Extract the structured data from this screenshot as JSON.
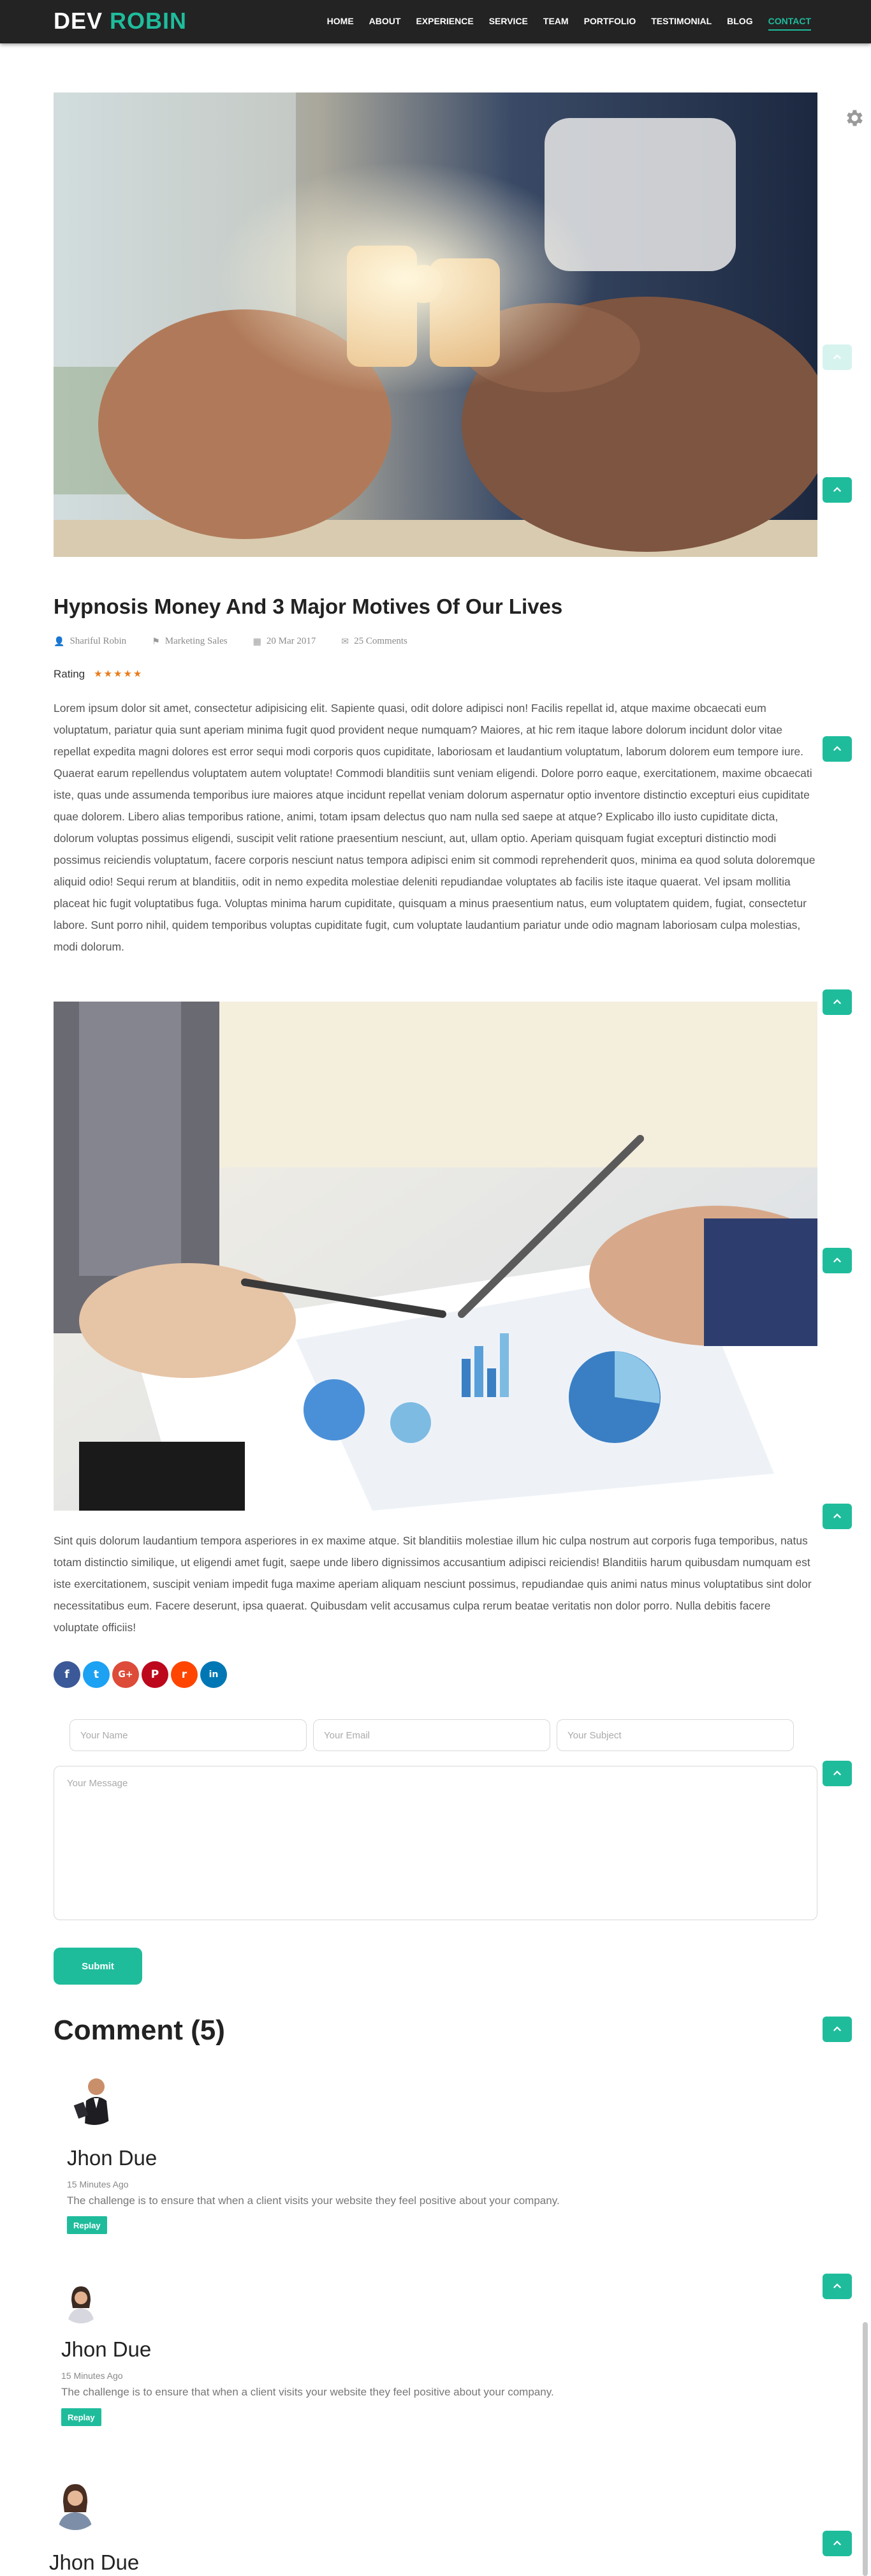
{
  "header": {
    "logo_part1": "DEV",
    "logo_part2": "ROBIN",
    "nav": [
      "HOME",
      "ABOUT",
      "EXPERIENCE",
      "SERVICE",
      "TEAM",
      "PORTFOLIO",
      "TESTIMONIAL",
      "BLOG",
      "CONTACT"
    ],
    "active_nav": "CONTACT"
  },
  "post": {
    "title": "Hypnosis Money And 3 Major Motives Of Our Lives",
    "author": "Shariful Robin",
    "category": "Marketing Sales",
    "date": "20 Mar 2017",
    "comments": "25 Comments",
    "rating_label": "Rating",
    "rating_stars": "★★★★★",
    "paragraph1": "Lorem ipsum dolor sit amet, consectetur adipisicing elit. Sapiente quasi, odit dolore adipisci non! Facilis repellat id, atque maxime obcaecati eum voluptatum, pariatur quia sunt aperiam minima fugit quod provident neque numquam? Maiores, at hic rem itaque labore dolorum incidunt dolor vitae repellat expedita magni dolores est error sequi modi corporis quos cupiditate, laboriosam et laudantium voluptatum, laborum dolorem eum tempore iure. Quaerat earum repellendus voluptatem autem voluptate! Commodi blanditiis sunt veniam eligendi. Dolore porro eaque, exercitationem, maxime obcaecati iste, quas unde assumenda temporibus iure maiores atque incidunt repellat veniam dolorum aspernatur optio inventore distinctio excepturi eius cupiditate quae dolorem. Libero alias temporibus ratione, animi, totam ipsam delectus quo nam nulla sed saepe at atque? Explicabo illo iusto cupiditate dicta, dolorum voluptas possimus eligendi, suscipit velit ratione praesentium nesciunt, aut, ullam optio. Aperiam quisquam fugiat excepturi distinctio modi possimus reiciendis voluptatum, facere corporis nesciunt natus tempora adipisci enim sit commodi reprehenderit quos, minima ea quod soluta doloremque aliquid odio! Sequi rerum at blanditiis, odit in nemo expedita molestiae deleniti repudiandae voluptates ab facilis iste itaque quaerat. Vel ipsam mollitia placeat hic fugit voluptatibus fuga. Voluptas minima harum cupiditate, quisquam a minus praesentium natus, eum voluptatem quidem, fugiat, consectetur labore. Sunt porro nihil, quidem temporibus voluptas cupiditate fugit, cum voluptate laudantium pariatur unde odio magnam laboriosam culpa molestias, modi dolorum.",
    "paragraph2": "Sint quis dolorum laudantium tempora asperiores in ex maxime atque. Sit blanditiis molestiae illum hic culpa nostrum aut corporis fuga temporibus, natus totam distinctio similique, ut eligendi amet fugit, saepe unde libero dignissimos accusantium adipisci reiciendis! Blanditiis harum quibusdam numquam est iste exercitationem, suscipit veniam impedit fuga maxime aperiam aliquam nesciunt possimus, repudiandae quis animi natus minus voluptatibus sint dolor necessitatibus eum. Facere deserunt, ipsa quaerat. Quibusdam velit accusamus culpa rerum beatae veritatis non dolor porro. Nulla debitis facere voluptate officiis!"
  },
  "social": [
    {
      "icon": "facebook-icon",
      "glyph": "f",
      "color": "#3b5998"
    },
    {
      "icon": "twitter-icon",
      "glyph": "t",
      "color": "#1da1f2"
    },
    {
      "icon": "google-plus-icon",
      "glyph": "G+",
      "color": "#dd4b39"
    },
    {
      "icon": "pinterest-icon",
      "glyph": "P",
      "color": "#bd081c"
    },
    {
      "icon": "reddit-icon",
      "glyph": "r",
      "color": "#ff4500"
    },
    {
      "icon": "linkedin-icon",
      "glyph": "in",
      "color": "#0077b5"
    }
  ],
  "form": {
    "name_placeholder": "Your Name",
    "email_placeholder": "Your Email",
    "subject_placeholder": "Your Subject",
    "message_placeholder": "Your Message",
    "submit_label": "Submit"
  },
  "comments": {
    "heading": "Comment (5)",
    "items": [
      {
        "name": "Jhon Due",
        "time": "15 Minutes Ago",
        "text": "The challenge is to ensure that when a client visits your website they feel positive about your company.",
        "reply_label": "Replay"
      },
      {
        "name": "Jhon Due",
        "time": "15 Minutes Ago",
        "text": "The challenge is to ensure that when a client visits your website they feel positive about your company.",
        "reply_label": "Replay"
      },
      {
        "name": "Jhon Due"
      }
    ]
  },
  "colors": {
    "accent": "#1fbc9c",
    "header_bg": "#232323",
    "star": "#e87b1a"
  }
}
